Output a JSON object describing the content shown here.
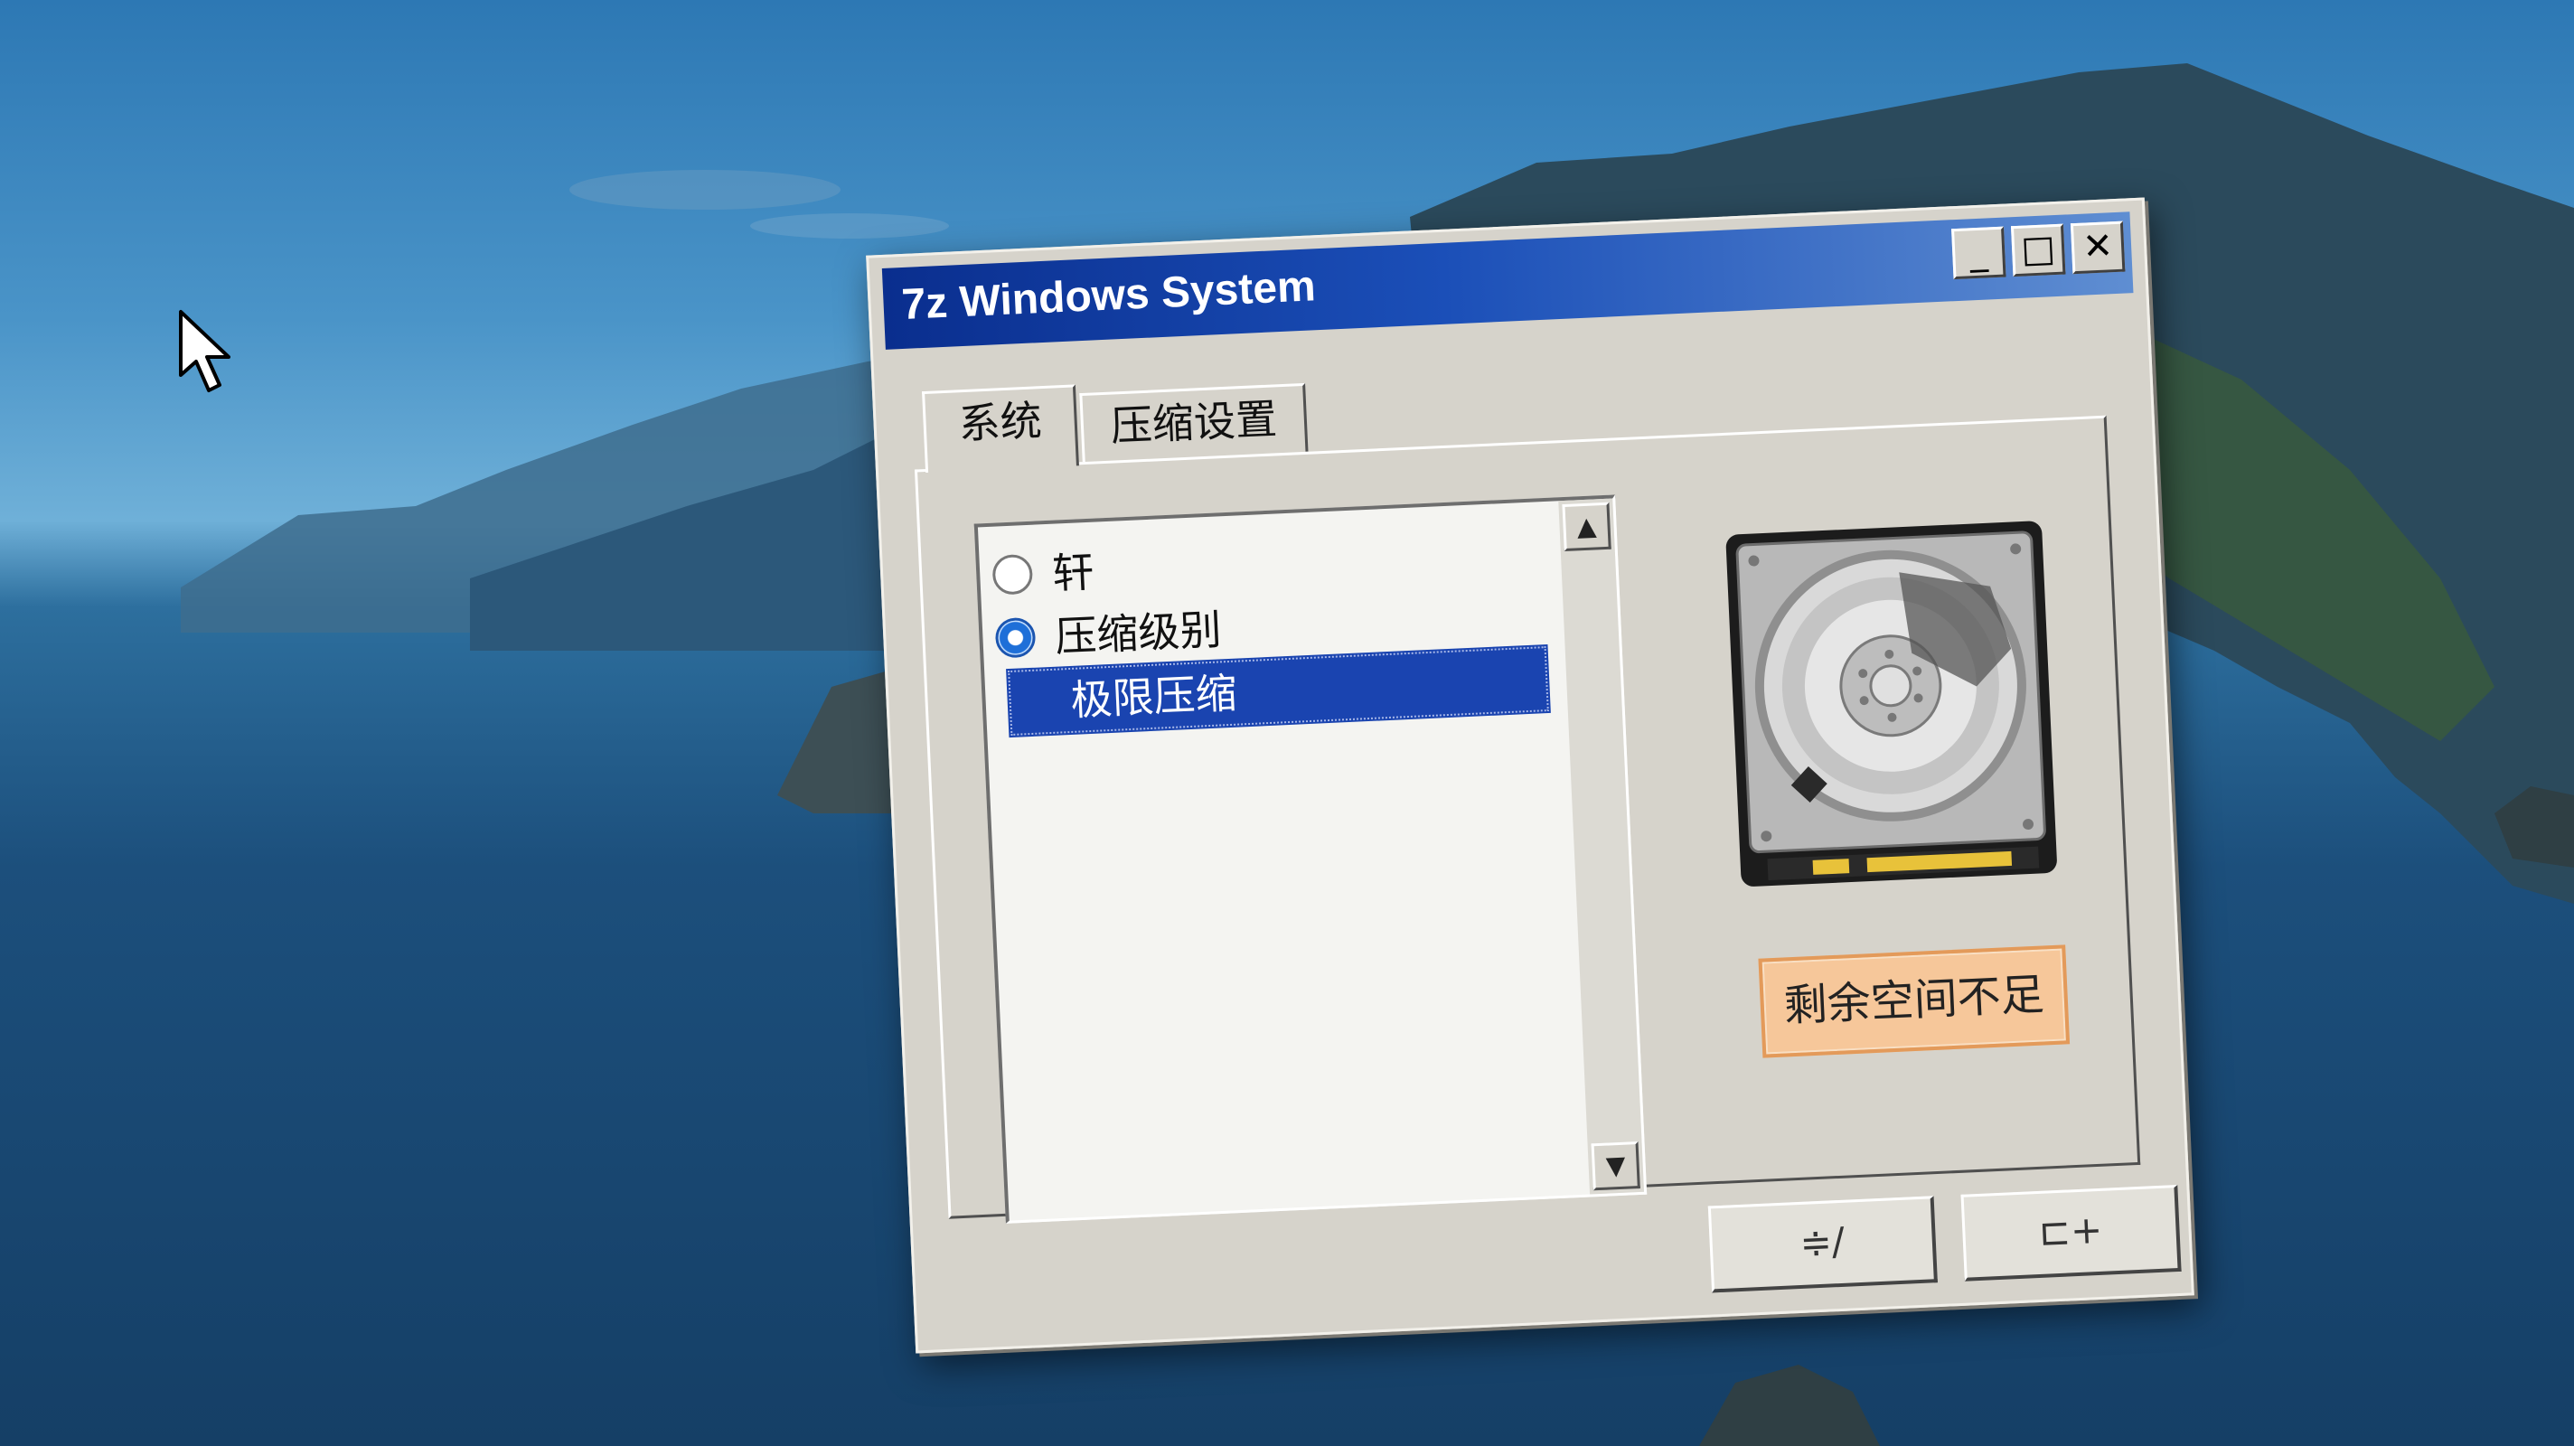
{
  "window": {
    "title": "7z Windows System",
    "controls": {
      "minimize": "_",
      "maximize": "□",
      "close": "✕"
    }
  },
  "tabs": [
    {
      "label": "系统",
      "active": true
    },
    {
      "label": "压缩设置",
      "active": false
    }
  ],
  "list": {
    "items": [
      {
        "label": "轩",
        "type": "radio",
        "checked": false
      },
      {
        "label": "压缩级别",
        "type": "radio",
        "checked": true
      },
      {
        "label": "极限压缩",
        "type": "option",
        "selected": true
      }
    ],
    "scroll_up": "▲",
    "scroll_down": "▼"
  },
  "disk": {
    "icon": "hard-disk-icon"
  },
  "warning": {
    "label": "剩余空间不足"
  },
  "buttons": {
    "ok": "≑∕",
    "cancel": "⊏+"
  },
  "colors": {
    "titlebar": "#0a2e8e",
    "selection": "#1a44b0",
    "warning_bg": "#f6c79a",
    "window_bg": "#d6d3cb"
  }
}
